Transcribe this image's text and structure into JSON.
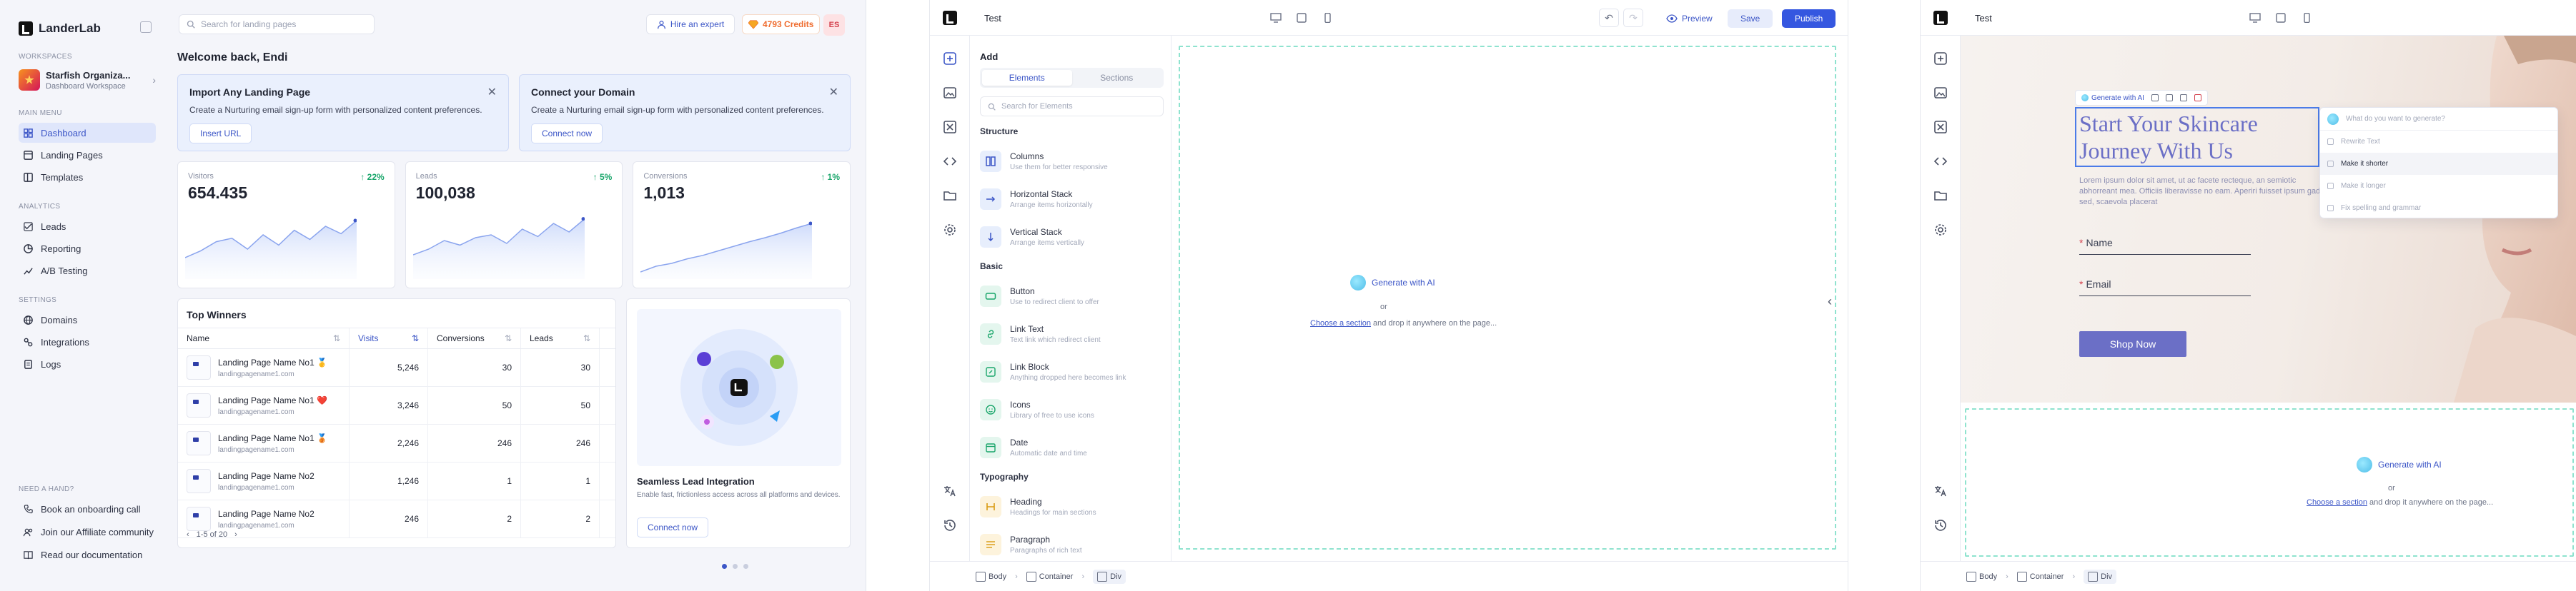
{
  "dashboard": {
    "brand": "LanderLab",
    "sidebar": {
      "workspace_label": "WORKSPACES",
      "workspace_name": "Starfish Organiza...",
      "workspace_sub": "Dashboard Workspace",
      "main_menu_label": "MAIN MENU",
      "main_menu": [
        {
          "label": "Dashboard",
          "icon": "dashboard-icon"
        },
        {
          "label": "Landing Pages",
          "icon": "landing-pages-icon"
        },
        {
          "label": "Templates",
          "icon": "templates-icon"
        }
      ],
      "analytics_label": "ANALYTICS",
      "analytics": [
        {
          "label": "Leads",
          "icon": "leads-icon"
        },
        {
          "label": "Reporting",
          "icon": "reporting-icon"
        },
        {
          "label": "A/B Testing",
          "icon": "ab-testing-icon"
        }
      ],
      "settings_label": "SETTINGS",
      "settings": [
        {
          "label": "Domains",
          "icon": "globe-icon"
        },
        {
          "label": "Integrations",
          "icon": "integrations-icon"
        },
        {
          "label": "Logs",
          "icon": "logs-icon"
        }
      ],
      "help_label": "NEED A HAND?",
      "help": [
        {
          "label": "Book an onboarding call",
          "icon": "phone-icon"
        },
        {
          "label": "Join our Affiliate community",
          "icon": "community-icon"
        },
        {
          "label": "Read our documentation",
          "icon": "book-icon"
        }
      ]
    },
    "topbar": {
      "search_placeholder": "Search for landing pages",
      "hire": "Hire an expert",
      "credits": "4793 Credits",
      "avatar": "ES"
    },
    "welcome": "Welcome back, Endi",
    "cards": [
      {
        "title": "Import Any Landing Page",
        "desc": "Create a Nurturing email sign-up form with personalized content preferences.",
        "button": "Insert URL"
      },
      {
        "title": "Connect your Domain",
        "desc": "Create a Nurturing email sign-up form with personalized content preferences.",
        "button": "Connect now"
      }
    ],
    "stats": [
      {
        "label": "Visitors",
        "value": "654.435",
        "pct": "22%",
        "trend": [
          0.7,
          0.58,
          0.42,
          0.36,
          0.55,
          0.3,
          0.48,
          0.22,
          0.38,
          0.15,
          0.28,
          0.05
        ]
      },
      {
        "label": "Leads",
        "value": "100,038",
        "pct": "5%",
        "trend": [
          0.65,
          0.55,
          0.4,
          0.48,
          0.35,
          0.3,
          0.45,
          0.2,
          0.33,
          0.1,
          0.25,
          0.02
        ]
      },
      {
        "label": "Conversions",
        "value": "1,013",
        "pct": "1%",
        "trend": [
          0.95,
          0.85,
          0.8,
          0.72,
          0.66,
          0.58,
          0.5,
          0.42,
          0.35,
          0.27,
          0.18,
          0.1
        ]
      }
    ],
    "top_winners": {
      "title": "Top Winners",
      "columns": [
        "Name",
        "Visits",
        "Conversions",
        "Leads"
      ],
      "rows": [
        {
          "name": "Landing Page Name No1",
          "url": "landingpagename1.com",
          "visits": "5,246",
          "conversions": "30",
          "leads": "30",
          "medal": "🥇"
        },
        {
          "name": "Landing Page Name No1",
          "url": "landingpagename1.com",
          "visits": "3,246",
          "conversions": "50",
          "leads": "50",
          "medal": "❤️"
        },
        {
          "name": "Landing Page Name No1",
          "url": "landingpagename1.com",
          "visits": "2,246",
          "conversions": "246",
          "leads": "246",
          "medal": "🥉"
        },
        {
          "name": "Landing Page Name No2",
          "url": "landingpagename1.com",
          "visits": "1,246",
          "conversions": "1",
          "leads": "1",
          "medal": ""
        },
        {
          "name": "Landing Page Name No2",
          "url": "landingpagename1.com",
          "visits": "246",
          "conversions": "2",
          "leads": "2",
          "medal": ""
        }
      ],
      "pager": "1-5 of 20"
    },
    "promo": {
      "title": "Seamless Lead Integration",
      "desc": "Enable fast, frictionless access across all platforms and devices.",
      "button": "Connect now"
    }
  },
  "editor": {
    "title": "Test",
    "preview": "Preview",
    "save": "Save",
    "publish": "Publish",
    "add_title": "Add",
    "tabs": [
      "Elements",
      "Sections"
    ],
    "search_placeholder": "Search for Elements",
    "groups": [
      {
        "name": "Structure",
        "items": [
          {
            "name": "Columns",
            "desc": "Use them for better responsive",
            "color": "blue"
          },
          {
            "name": "Horizontal Stack",
            "desc": "Arrange items horizontally",
            "color": "blue"
          },
          {
            "name": "Vertical Stack",
            "desc": "Arrange items vertically",
            "color": "blue"
          }
        ]
      },
      {
        "name": "Basic",
        "items": [
          {
            "name": "Button",
            "desc": "Use to redirect client to offer",
            "color": "green"
          },
          {
            "name": "Link Text",
            "desc": "Text link which redirect client",
            "color": "green"
          },
          {
            "name": "Link Block",
            "desc": "Anything dropped here becomes link",
            "color": "green"
          },
          {
            "name": "Icons",
            "desc": "Library of free to use icons",
            "color": "green"
          },
          {
            "name": "Date",
            "desc": "Automatic date and time",
            "color": "green"
          }
        ]
      },
      {
        "name": "Typography",
        "items": [
          {
            "name": "Heading",
            "desc": "Headings for main sections",
            "color": "yellow"
          },
          {
            "name": "Paragraph",
            "desc": "Paragraphs of rich text",
            "color": "yellow"
          }
        ]
      }
    ],
    "canvas": {
      "generate": "Generate with AI",
      "or": "or",
      "choose_link": "Choose a section",
      "choose_rest": " and drop it anywhere on the page..."
    },
    "crumbs": [
      "Body",
      "Container",
      "Div"
    ]
  },
  "skincare": {
    "title": "Test",
    "toolbar_ai": "Generate with AI",
    "headline": "Start Your Skincare Journey With Us",
    "lorem": "Lorem ipsum dolor sit amet, ut ac facete recteque, an semiotic abhorreant mea. Officiis liberavisse no eam. Aperiri fuisset ipsum gad sed, scaevola placerat",
    "field_name": "Name",
    "field_email": "Email",
    "shop": "Shop Now",
    "ai_menu": {
      "placeholder": "What do you want to generate?",
      "items": [
        "Rewrite Text",
        "Make it shorter",
        "Make it longer",
        "Fix spelling and grammar"
      ]
    },
    "canvas": {
      "generate": "Generate with AI",
      "or": "or",
      "choose_link": "Choose a section",
      "choose_rest": " and drop it anywhere on the page..."
    },
    "crumbs": [
      "Body",
      "Container",
      "Div"
    ]
  },
  "colors": {
    "accent": "#3c56c7",
    "publish": "#3557e0",
    "success": "#1aa66b",
    "credits": "#ef6c2f",
    "headline": "#6b6fc6",
    "dropzone": "#8fe3cf"
  }
}
